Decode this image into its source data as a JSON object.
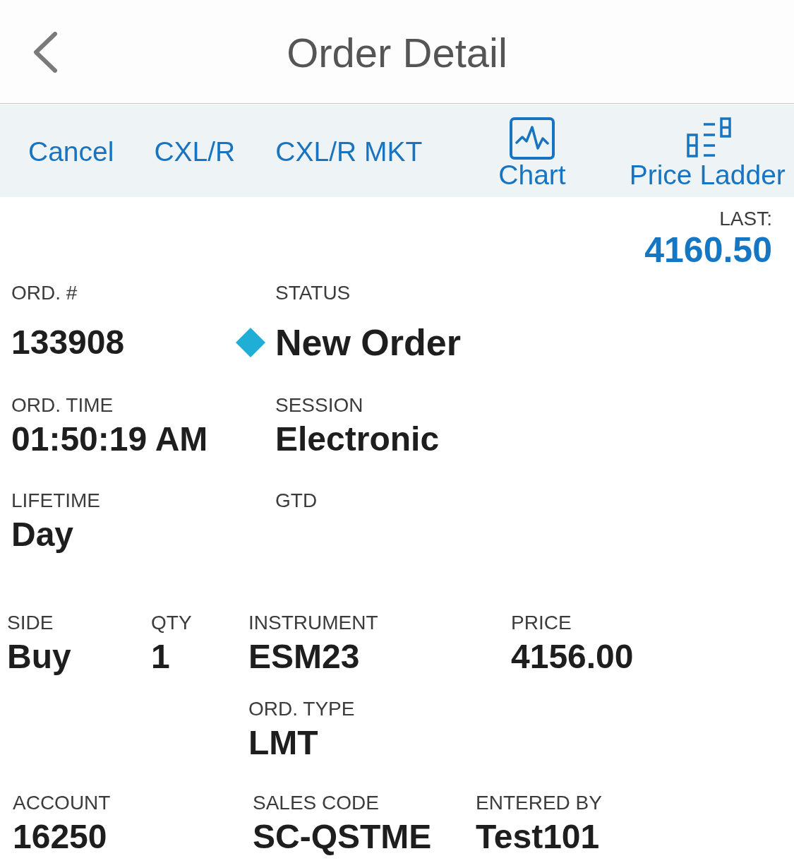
{
  "header": {
    "title": "Order Detail"
  },
  "toolbar": [
    {
      "kind": "text",
      "label": "Cancel"
    },
    {
      "kind": "text",
      "label": "CXL/R"
    },
    {
      "kind": "text",
      "label": "CXL/R MKT"
    },
    {
      "kind": "chart",
      "label": "Chart"
    },
    {
      "kind": "ladder",
      "label": "Price Ladder"
    }
  ],
  "last_price": {
    "label": "LAST:",
    "value": "4160.50"
  },
  "order_info": [
    [
      {
        "label": "ORD. #",
        "value": "133908"
      },
      {
        "label": "STATUS",
        "value": "New Order",
        "color": "#1eaed6"
      }
    ],
    [
      {
        "label": "ORD. TIME",
        "value": "01:50:19 AM"
      },
      {
        "label": "SESSION",
        "value": "Electronic"
      }
    ],
    [
      {
        "label": "LIFETIME",
        "value": "Day"
      },
      {
        "label": "GTD"
      }
    ]
  ],
  "trade": [
    [
      {
        "label": "SIDE",
        "value": "Buy"
      }
    ],
    [
      {
        "label": "QTY",
        "value": "1"
      }
    ],
    [
      {
        "label": "INSTRUMENT",
        "value": "ESM23"
      },
      {
        "label": "ORD. TYPE",
        "value": "LMT"
      }
    ],
    [
      {
        "label": "PRICE",
        "value": "4156.00"
      }
    ]
  ],
  "account_info": [
    {
      "label": "ACCOUNT",
      "value": "16250"
    },
    {
      "label": "SALES CODE",
      "value": "SC-QSTME"
    },
    {
      "label": "ENTERED BY",
      "value": "Test101"
    }
  ]
}
